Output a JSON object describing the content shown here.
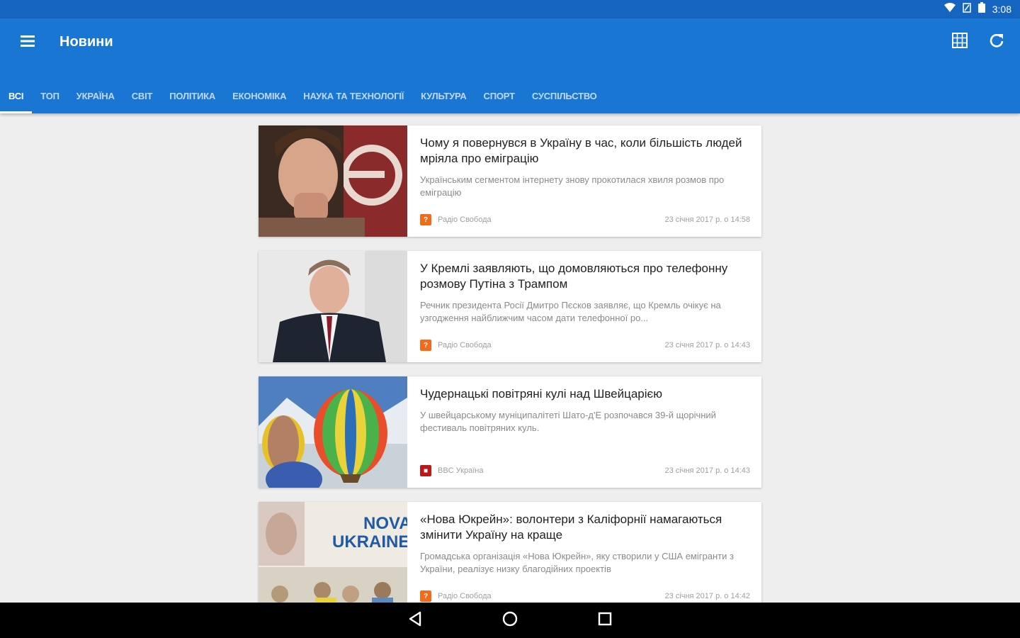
{
  "status_bar": {
    "time": "3:08",
    "icons": [
      "wifi-icon",
      "signal-icon",
      "battery-icon"
    ]
  },
  "toolbar": {
    "title": "Новини",
    "menu_icon": "menu-icon",
    "grid_icon": "grid-view-icon",
    "refresh_icon": "refresh-icon"
  },
  "tabs": [
    {
      "label": "ВСІ",
      "active": true
    },
    {
      "label": "ТОП",
      "active": false
    },
    {
      "label": "УКРАЇНА",
      "active": false
    },
    {
      "label": "СВІТ",
      "active": false
    },
    {
      "label": "ПОЛІТИКА",
      "active": false
    },
    {
      "label": "ЕКОНОМІКА",
      "active": false
    },
    {
      "label": "НАУКА ТА ТЕХНОЛОГІЇ",
      "active": false
    },
    {
      "label": "КУЛЬТУРА",
      "active": false
    },
    {
      "label": "СПОРТ",
      "active": false
    },
    {
      "label": "СУСПІЛЬСТВО",
      "active": false
    }
  ],
  "articles": [
    {
      "title": "Чому я повернувся в Україну в час, коли більшість людей мріяла про еміграцію",
      "description": "Українським сегментом інтернету знову прокотилася хвиля розмов про еміграцію",
      "source": "Радіо Свобода",
      "source_icon": "radio-svoboda-icon",
      "source_color": "#f26a1b",
      "date": "23 січня 2017 р. о 14:58"
    },
    {
      "title": "У Кремлі заявляють, що домовляються про телефонну розмову Путіна з Трампом",
      "description": "Речник президента Росії Дмитро Пєсков заявляє, що Кремль очікує на узгодження найближчим часом дати телефонної ро...",
      "source": "Радіо Свобода",
      "source_icon": "radio-svoboda-icon",
      "source_color": "#f26a1b",
      "date": "23 січня 2017 р. о 14:43"
    },
    {
      "title": "Чудернацькі повітряні кулі над Швейцарією",
      "description": "У швейцарському муніципалітеті Шато-д'Е розпочався 39-й щорічний фестиваль повітряних куль.",
      "source": "BBC Україна",
      "source_icon": "bbc-icon",
      "source_color": "#bb1919",
      "date": "23 січня 2017 р. о 14:43"
    },
    {
      "title": "«Нова Юкрейн»: волонтери з Каліфорнії намагаються змінити Україну на краще",
      "description": "Громадська організація «Нова Юкрейн», яку створили у США емігранти з України, реалізує низку благодійних проектів",
      "source": "Радіо Свобода",
      "source_icon": "radio-svoboda-icon",
      "source_color": "#f26a1b",
      "date": "23 січня 2017 р. о 14:42",
      "thumb_text": "NOVA UKRAINE"
    }
  ],
  "nav_bar": {
    "back": "back-icon",
    "home": "home-icon",
    "recents": "recents-icon"
  }
}
